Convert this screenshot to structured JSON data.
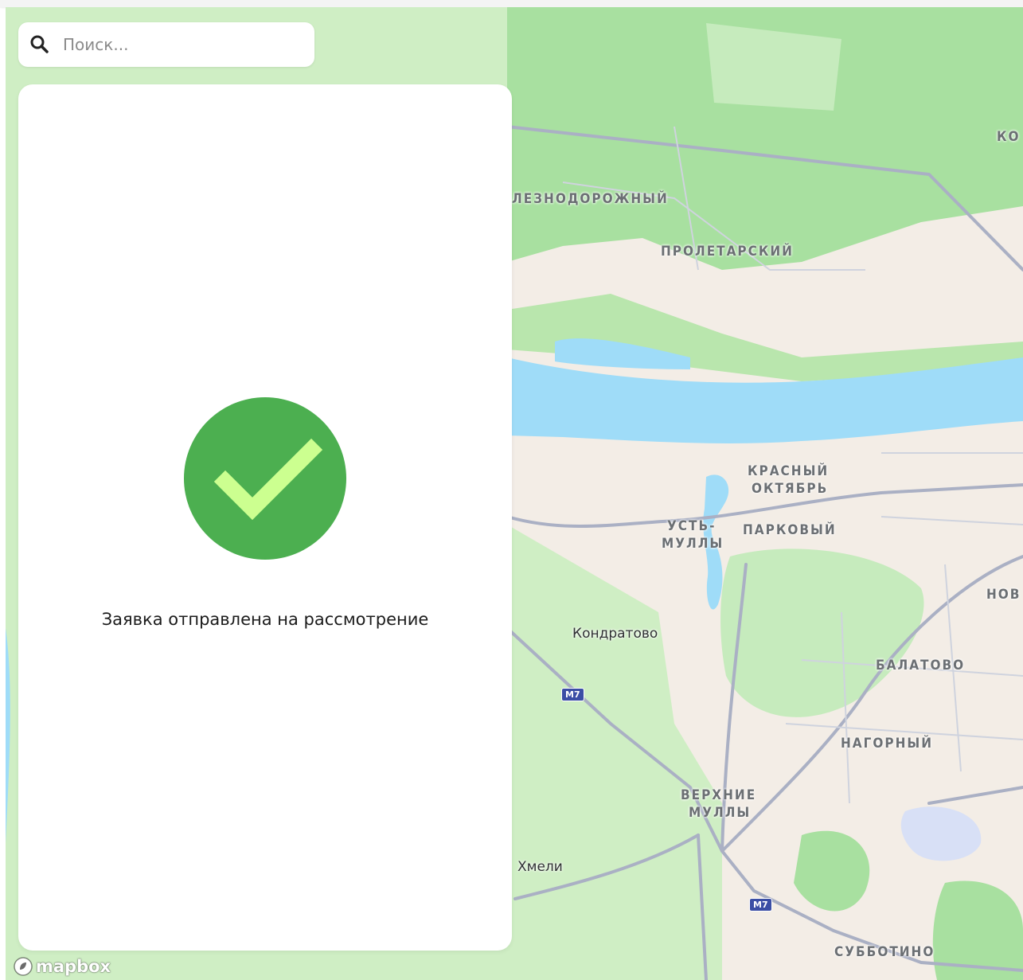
{
  "search": {
    "placeholder": "Поиск..."
  },
  "panel": {
    "status_message": "Заявка отправлена на рассмотрение",
    "success_color": "#4caf50",
    "check_color": "#ccff90"
  },
  "map": {
    "attribution_logo": "mapbox",
    "place_labels": {
      "zheleznodorozhny": "ЛЕЗНОДОРОЖНЫЙ",
      "proletarsky": "ПРОЛЕТАРСКИЙ",
      "ko": "КО",
      "krasny_oktyabr_1": "КРАСНЫЙ",
      "krasny_oktyabr_2": "ОКТЯБРЬ",
      "ust_mully_1": "УСТЬ-",
      "ust_mully_2": "МУЛЛЫ",
      "parkovy": "ПАРКОВЫЙ",
      "nov": "НОВ",
      "balatovo": "БАЛАТОВО",
      "nagorny": "НАГОРНЫЙ",
      "verkhnie_mully_1": "ВЕРХНИЕ",
      "verkhnie_mully_2": "МУЛЛЫ",
      "subbotino": "СУББОТИНО"
    },
    "town_labels": {
      "kondratovo": "Кондратово",
      "khmeli": "Хмели"
    },
    "road_shields": [
      "М7",
      "М7"
    ],
    "colors": {
      "land": "#f3ede6",
      "park": "#a8e0a0",
      "forest": "#bfe8b4",
      "water": "#9fdcf8",
      "road": "#aab0c4"
    }
  }
}
